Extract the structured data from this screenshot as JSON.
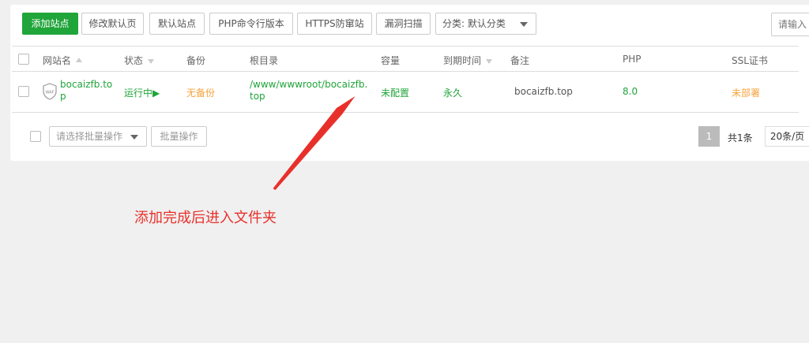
{
  "toolbar": {
    "add_site": "添加站点",
    "modify_default_page": "修改默认页",
    "default_site": "默认站点",
    "php_cli_version": "PHP命令行版本",
    "https_anti_tamper": "HTTPS防窜站",
    "vuln_scan": "漏洞扫描",
    "category_select": "分类: 默认分类",
    "search_placeholder": "请输入"
  },
  "table": {
    "headers": {
      "site_name": "网站名",
      "status": "状态",
      "backup": "备份",
      "root_dir": "根目录",
      "capacity": "容量",
      "expire": "到期时间",
      "note": "备注",
      "php": "PHP",
      "ssl": "SSL证书"
    },
    "rows": [
      {
        "site_line1": "bocaizfb.to",
        "site_line2": "p",
        "waf_badge": "WAF",
        "status": "运行中▶",
        "backup": "无备份",
        "root_line1": "/www/wwwroot/bocaizfb.",
        "root_line2": "top",
        "capacity": "未配置",
        "expire": "永久",
        "note": "bocaizfb.top",
        "php": "8.0",
        "ssl": "未部署"
      }
    ]
  },
  "footer": {
    "batch_select": "请选择批量操作",
    "batch_button": "批量操作",
    "page_current": "1",
    "total": "共1条",
    "page_size": "20条/页"
  },
  "annotation": {
    "text": "添加完成后进入文件夹"
  },
  "colors": {
    "primary": "#20a53a",
    "warning": "#f7a23c",
    "annotation": "#e8302a"
  }
}
